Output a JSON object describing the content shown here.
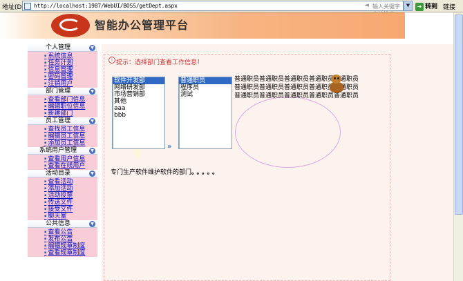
{
  "browser": {
    "address_label": "地址(D)",
    "url": "http://localhost:1987/WebUI/BOSS/getDept.aspx",
    "search_hint": "输入关键字 直接搜索",
    "go_label": "转到",
    "links_label": "链接"
  },
  "banner": {
    "title": "智能办公管理平台"
  },
  "sidebar": {
    "sections": [
      {
        "title": "个人管理",
        "items": [
          "系统信息",
          "任务计划",
          "信息管理",
          "密码管理",
          "注销用户"
        ]
      },
      {
        "title": "部门管理",
        "items": [
          "查看部门信息",
          "编辑职位信息",
          "新建部门"
        ]
      },
      {
        "title": "员工管理",
        "items": [
          "查找员工信息",
          "编辑员工信息",
          "添加员工信息"
        ]
      },
      {
        "title": "系统用户管理",
        "items": [
          "查看用户信息",
          "查看在线用户"
        ]
      },
      {
        "title": "活动目录",
        "items": [
          "查看活动",
          "添加活动",
          "活动投票",
          "传送文件",
          "接受文件",
          "聊天室"
        ]
      },
      {
        "title": "公共信息",
        "items": [
          "查看公告",
          "发布公告",
          "编辑规章制度",
          "查看规章制度"
        ]
      }
    ]
  },
  "content": {
    "hint": "提示：选择部门查看工作信息！",
    "departments": [
      "软件开发部",
      "网络研发部",
      "市场营销部",
      "其他",
      "aaa",
      "bbb"
    ],
    "selected_department": 0,
    "positions": [
      "普通职员",
      "程序员",
      "测试"
    ],
    "selected_position": 0,
    "staff_lines": [
      "普通职员普通职员普通职员普通职员普通职员",
      "普通职员普通职员普通职员普通职员普通职员",
      "普通职员普通职员普通职员普通职员普通职员"
    ],
    "description": "专门生产软件维护软件的部门",
    "description_suffix": "。。。。。"
  }
}
